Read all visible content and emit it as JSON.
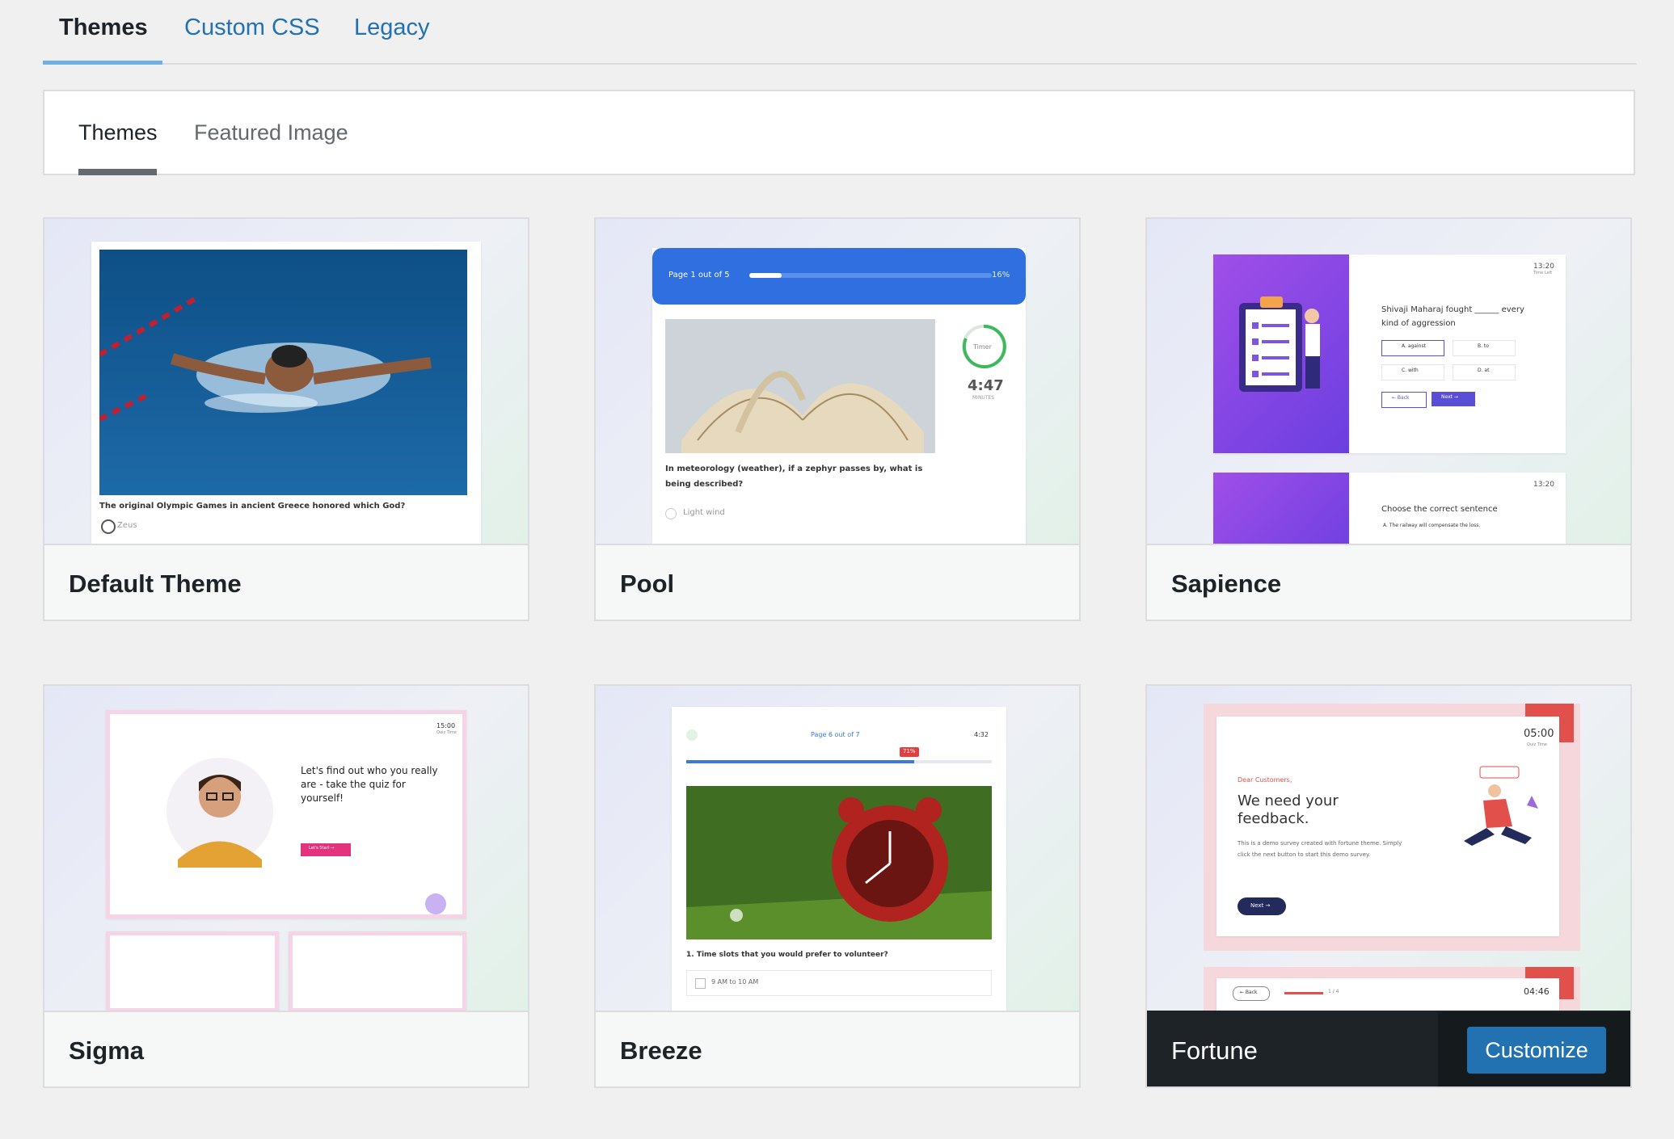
{
  "top_tabs": [
    {
      "label": "Themes",
      "active": true
    },
    {
      "label": "Custom CSS",
      "active": false
    },
    {
      "label": "Legacy",
      "active": false
    }
  ],
  "sub_tabs": [
    {
      "label": "Themes",
      "active": true
    },
    {
      "label": "Featured Image",
      "active": false
    }
  ],
  "themes": [
    {
      "name": "Default Theme",
      "preview": {
        "question": "The original Olympic Games in ancient Greece honored which God?",
        "option": "Zeus"
      }
    },
    {
      "name": "Pool",
      "preview": {
        "progress": "Page 1 out of 5",
        "percent": "16%",
        "timer_label": "Timer",
        "timer": "4:47",
        "timer_unit": "MINUTES",
        "question": "In meteorology (weather), if a zephyr passes by, what is being described?",
        "option": "Light wind"
      }
    },
    {
      "name": "Sapience",
      "preview": {
        "time": "13:20",
        "time_label": "Time Left",
        "question": "Shivaji Maharaj fought ______ every kind of aggression",
        "options": [
          "A. against",
          "B. to",
          "C. with",
          "D. at"
        ],
        "back": "← Back",
        "next": "Next →",
        "question2": "Choose the correct sentence",
        "option2": "A. The railway will compensate the loss."
      }
    },
    {
      "name": "Sigma",
      "preview": {
        "time": "15:00",
        "time_label": "Quiz Time",
        "headline": "Let's find out who you really are - take the quiz for yourself!",
        "start": "Let's Start →"
      }
    },
    {
      "name": "Breeze",
      "preview": {
        "progress": "Page 6 out of 7",
        "time": "4:32",
        "percent": "71%",
        "question": "1. Time slots that you would prefer to volunteer?",
        "option": "9 AM to 10 AM"
      }
    },
    {
      "name": "Fortune",
      "active": true,
      "preview": {
        "time": "05:00",
        "time_label": "Quiz Time",
        "greeting": "Dear Customers,",
        "headline": "We need your feedback.",
        "body": "This is a demo survey created with fortune theme. Simply click the next button to start this demo survey.",
        "next": "Next →",
        "back": "← Back",
        "page": "1 / 4",
        "time2": "04:46"
      }
    }
  ],
  "actions": {
    "customize": "Customize"
  },
  "colors": {
    "accent": "#2271b1",
    "active_bar": "#1d2327",
    "tab_underline": "#72aee6"
  }
}
